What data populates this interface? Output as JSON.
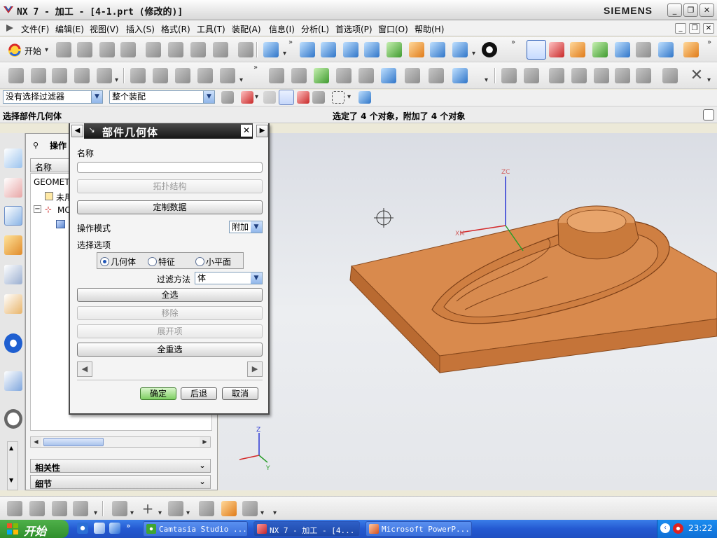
{
  "titlebar": {
    "title": "NX 7 - 加工 - [4-1.prt (修改的)]",
    "brand": "SIEMENS",
    "minimize": "_",
    "restore": "❐",
    "close": "✕"
  },
  "menubar": {
    "items": [
      "文件(F)",
      "编辑(E)",
      "视图(V)",
      "插入(S)",
      "格式(R)",
      "工具(T)",
      "装配(A)",
      "信息(I)",
      "分析(L)",
      "首选项(P)",
      "窗口(O)",
      "帮助(H)"
    ]
  },
  "toolbar": {
    "start_label": "开始"
  },
  "selection_bar": {
    "filter_value": "没有选择过滤器",
    "scope_value": "整个装配"
  },
  "status": {
    "prompt": "选择部件几何体",
    "message": "选定了 4 个对象，附加了 4 个对象"
  },
  "navigator": {
    "title": "操作",
    "column_name": "名称",
    "rows": [
      "GEOMETR",
      "未用",
      "MCS"
    ],
    "section_dependencies": "相关性",
    "section_details": "细节"
  },
  "dialog": {
    "title": "部件几何体",
    "name_label": "名称",
    "btn_topology": "拓扑结构",
    "btn_custom_data": "定制数据",
    "operation_mode_label": "操作模式",
    "operation_mode_value": "附加",
    "select_options_label": "选择选项",
    "radio_geometry": "几何体",
    "radio_feature": "特征",
    "radio_facet": "小平面",
    "filter_method_label": "过滤方法",
    "filter_method_value": "体",
    "btn_select_all": "全选",
    "btn_remove": "移除",
    "btn_expand": "展开项",
    "btn_reselect_all": "全重选",
    "ok": "确定",
    "back": "后退",
    "cancel": "取消"
  },
  "graphics": {
    "axis_z": "ZC",
    "axis_x": "XM",
    "triad_z": "Z",
    "triad_y": "Y"
  },
  "taskbar": {
    "start": "开始",
    "tasks": [
      "Camtasia Studio ...",
      "NX 7 - 加工 - [4...",
      "Microsoft PowerP..."
    ],
    "clock": "23:22"
  },
  "colors": {
    "part": "#d7874a",
    "part_dark": "#b4652c",
    "dialog_title_bg": "#1e1e1e",
    "taskbar": "#2459d1"
  }
}
